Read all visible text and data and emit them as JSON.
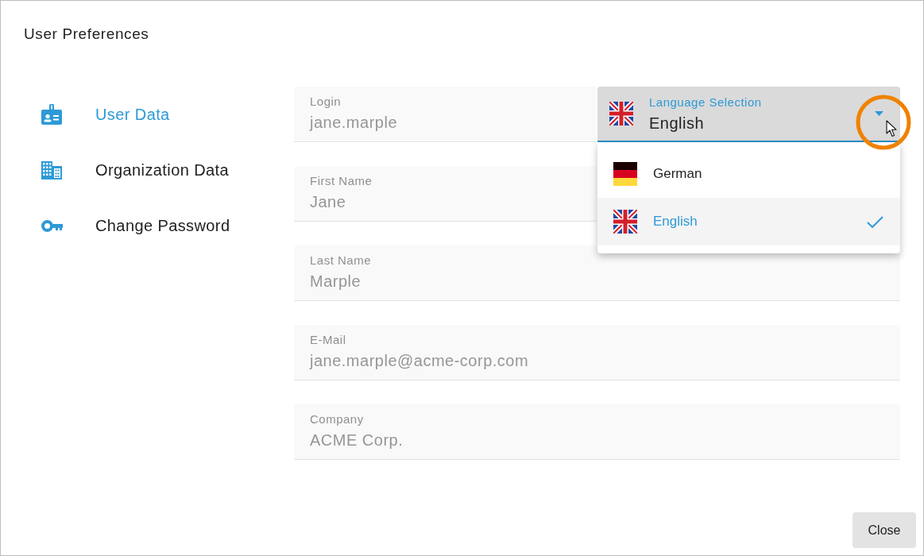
{
  "window": {
    "title": "User Preferences"
  },
  "sidebar": {
    "items": [
      {
        "label": "User Data",
        "selected": true
      },
      {
        "label": "Organization Data",
        "selected": false
      },
      {
        "label": "Change Password",
        "selected": false
      }
    ]
  },
  "form": {
    "fields": [
      {
        "label": "Login",
        "value": "jane.marple"
      },
      {
        "label": "First Name",
        "value": "Jane"
      },
      {
        "label": "Last Name",
        "value": "Marple"
      },
      {
        "label": "E-Mail",
        "value": "jane.marple@acme-corp.com"
      },
      {
        "label": "Company",
        "value": "ACME Corp."
      }
    ],
    "language_select": {
      "label": "Language Selection",
      "value": "English",
      "expanded": true,
      "options": [
        {
          "label": "German",
          "kind": "de",
          "selected": false
        },
        {
          "label": "English",
          "kind": "uk",
          "selected": true
        }
      ]
    }
  },
  "buttons": [
    {
      "label": "Close"
    }
  ]
}
